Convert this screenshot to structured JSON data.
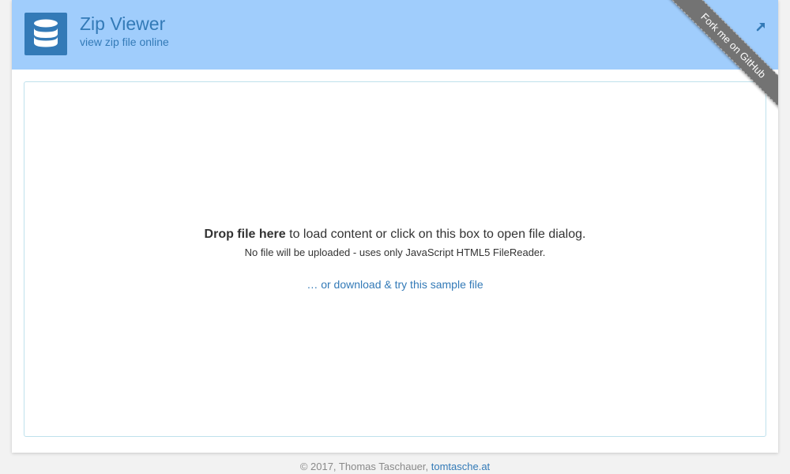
{
  "header": {
    "title": "Zip Viewer",
    "subtitle": "view zip file online",
    "logo_icon": "database-icon",
    "external_icon": "external-link-arrow-icon",
    "background_color": "#a0cdfc",
    "accent_color": "#337ab7"
  },
  "ribbon": {
    "label": "Fork me on GitHub",
    "color": "#737373"
  },
  "dropzone": {
    "bold_label": "Drop file here",
    "main_text": " to load content or click on this box to open file dialog.",
    "note": "No file will be uploaded - uses only JavaScript HTML5 FileReader.",
    "sample_link": "… or download & try this sample file"
  },
  "footer": {
    "copyright": "© 2017, Thomas Taschauer, ",
    "link_label": "tomtasche.at"
  }
}
